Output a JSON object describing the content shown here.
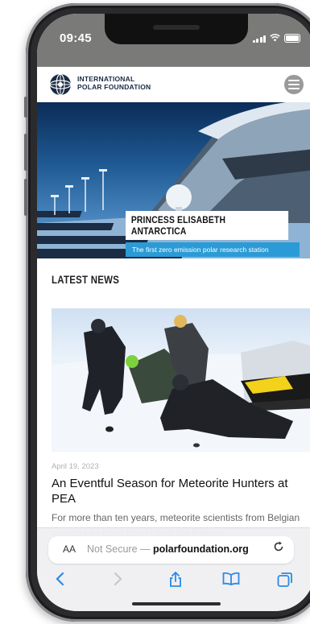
{
  "status_bar": {
    "time": "09:45"
  },
  "site": {
    "name_line1": "INTERNATIONAL",
    "name_line2": "POLAR FOUNDATION"
  },
  "hero": {
    "title": "PRINCESS ELISABETH ANTARCTICA",
    "subtitle": "The first zero emission polar research station"
  },
  "section": {
    "title": "LATEST NEWS"
  },
  "article": {
    "date": "April 19, 2023",
    "title": "An Eventful Season for Meteorite Hunters at PEA",
    "excerpt": "For more than ten years, meteorite scientists from Belgian universities have been using the Belgian"
  },
  "browser": {
    "aa_label": "AA",
    "security_label": "Not Secure",
    "separator": "—",
    "domain": "polarfoundation.org",
    "toolbar": [
      "back-icon",
      "forward-icon",
      "share-icon",
      "bookmarks-icon",
      "tabs-icon"
    ]
  },
  "colors": {
    "accent_blue": "#2a9bd6",
    "safari_blue": "#2a8ae6",
    "logo_navy": "#1a2b45"
  }
}
